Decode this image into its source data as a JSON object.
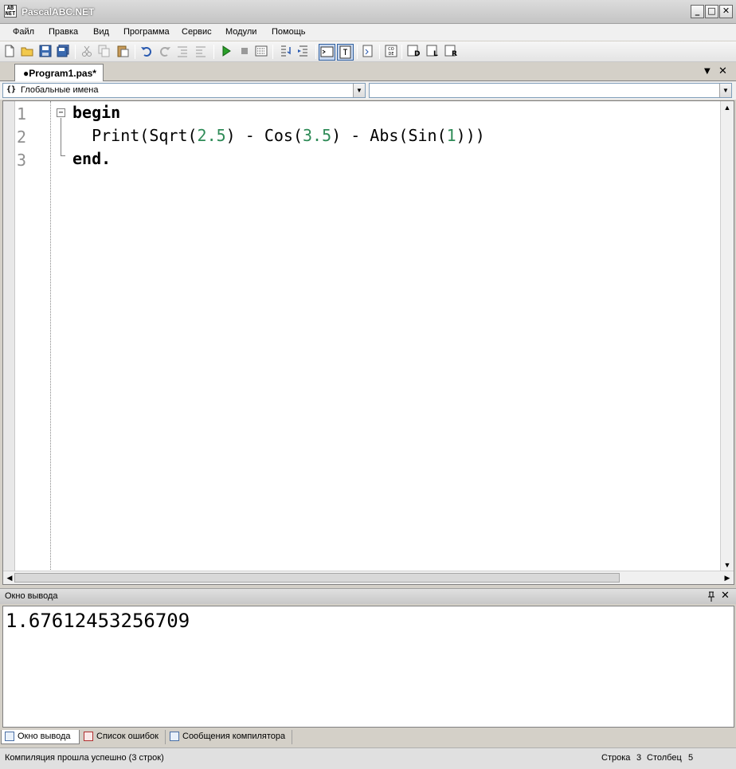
{
  "window": {
    "title": "PascalABC.NET",
    "app_icon_text": "AB\nNET"
  },
  "window_controls": {
    "minimize": "_",
    "maximize": "□",
    "close": "✕"
  },
  "menu": [
    "Файл",
    "Правка",
    "Вид",
    "Программа",
    "Сервис",
    "Модули",
    "Помощь"
  ],
  "toolbar_icons": [
    "new-file-icon",
    "open-icon",
    "save-icon",
    "save-all-icon",
    "cut-icon",
    "copy-icon",
    "paste-icon",
    "undo-icon",
    "redo-icon",
    "indent-icon",
    "outdent-icon",
    "run-icon",
    "stop-icon",
    "debug-icon",
    "step-into-icon",
    "step-over-icon",
    "output-icon",
    "watch-icon",
    "format-icon",
    "code-icon",
    "view-d-icon",
    "view-l-icon",
    "view-r-icon"
  ],
  "document_tab": {
    "label": "●Program1.pas*",
    "dropdown_icon": "▼",
    "close_icon": "✕"
  },
  "scope_dropdown": {
    "icon": "{}",
    "value": "Глобальные имена"
  },
  "member_dropdown": {
    "value": ""
  },
  "editor": {
    "line_numbers": [
      "1",
      "2",
      "3"
    ],
    "fold_marker": "−",
    "lines": [
      {
        "segments": [
          {
            "t": "begin",
            "k": "kw"
          }
        ]
      },
      {
        "segments": [
          {
            "t": "  Print(Sqrt(",
            "k": ""
          },
          {
            "t": "2.5",
            "k": "num"
          },
          {
            "t": ") - Cos(",
            "k": ""
          },
          {
            "t": "3.5",
            "k": "num"
          },
          {
            "t": ") - Abs(Sin(",
            "k": ""
          },
          {
            "t": "1",
            "k": "num"
          },
          {
            "t": ")))",
            "k": ""
          }
        ]
      },
      {
        "segments": [
          {
            "t": "end.",
            "k": "kw"
          }
        ]
      }
    ]
  },
  "output": {
    "title": "Окно вывода",
    "pin_icon": "📌",
    "close_icon": "✕",
    "text": "1.67612453256709"
  },
  "bottom_tabs": [
    "Окно вывода",
    "Список ошибок",
    "Сообщения компилятора"
  ],
  "status": {
    "message": "Компиляция прошла успешно (3 строк)",
    "row_label": "Строка",
    "row": "3",
    "col_label": "Столбец",
    "col": "5"
  },
  "colors": {
    "keyword": "#000000",
    "number": "#2e8b57",
    "line_number": "#909090"
  }
}
